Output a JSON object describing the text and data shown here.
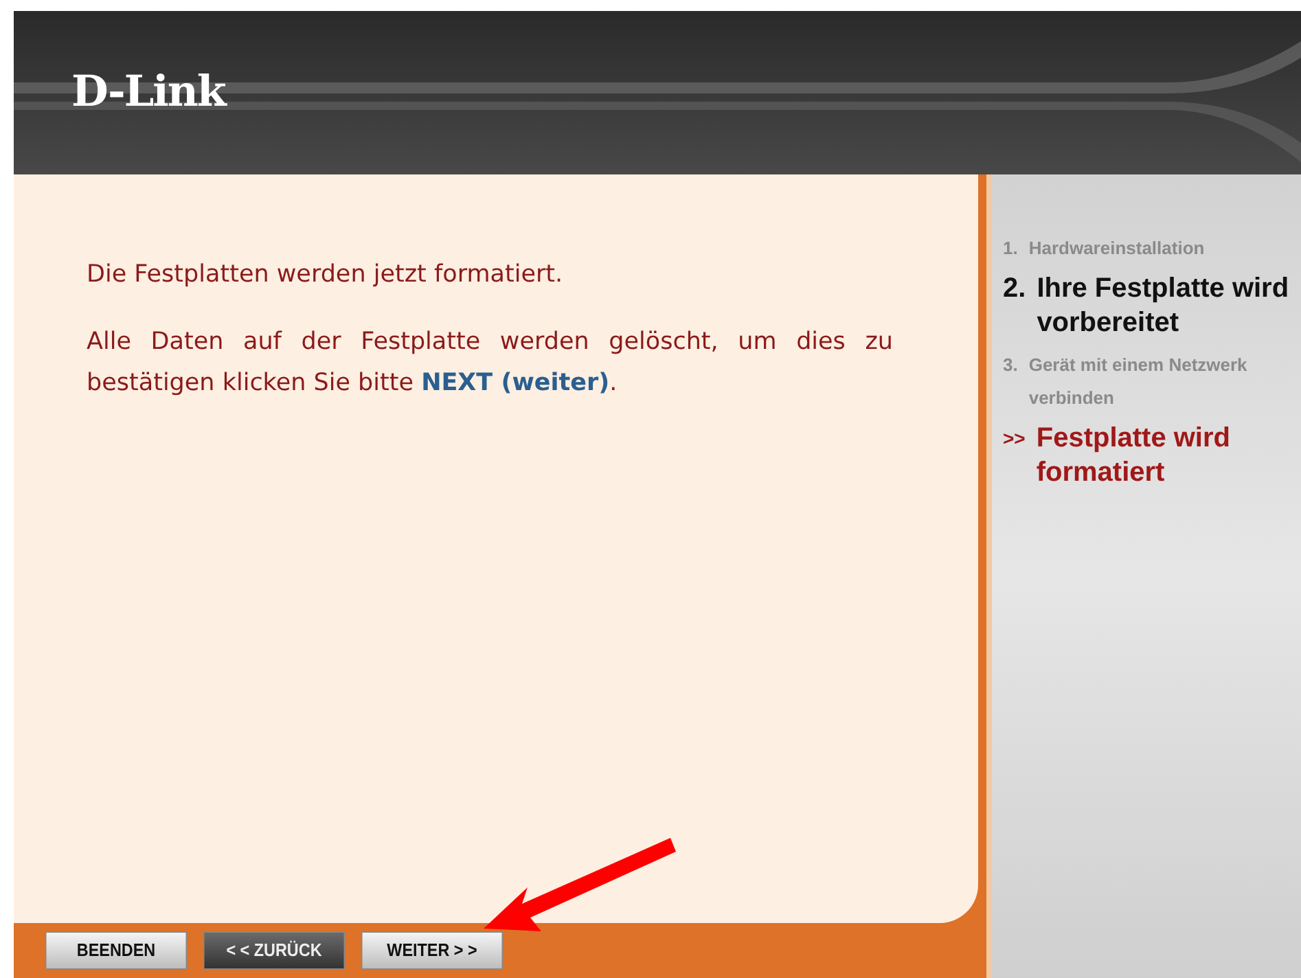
{
  "header": {
    "logo": "D-Link"
  },
  "content": {
    "paragraphs": [
      "Die Festplatten werden jetzt formatiert.",
      "Alle Daten auf der Festplatte werden gelöscht, um dies zu bestätigen klicken Sie bitte **NEXT (weiter)**."
    ]
  },
  "steps": [
    {
      "marker": "1.",
      "label": "Hardwareinstallation",
      "kind": "done"
    },
    {
      "marker": "2.",
      "label": "Ihre Festplatte wird vorbereitet",
      "kind": "current"
    },
    {
      "marker": "3.",
      "label": "Gerät mit einem Netzwerk verbinden",
      "kind": "pending"
    },
    {
      "marker": ">>",
      "label": "Festplatte wird formatiert",
      "kind": "active"
    }
  ],
  "buttons": [
    {
      "label": "BEENDEN",
      "kind": "light"
    },
    {
      "label": "< < ZURÜCK",
      "kind": "dark"
    },
    {
      "label": "WEITER > >",
      "kind": "light"
    }
  ]
}
